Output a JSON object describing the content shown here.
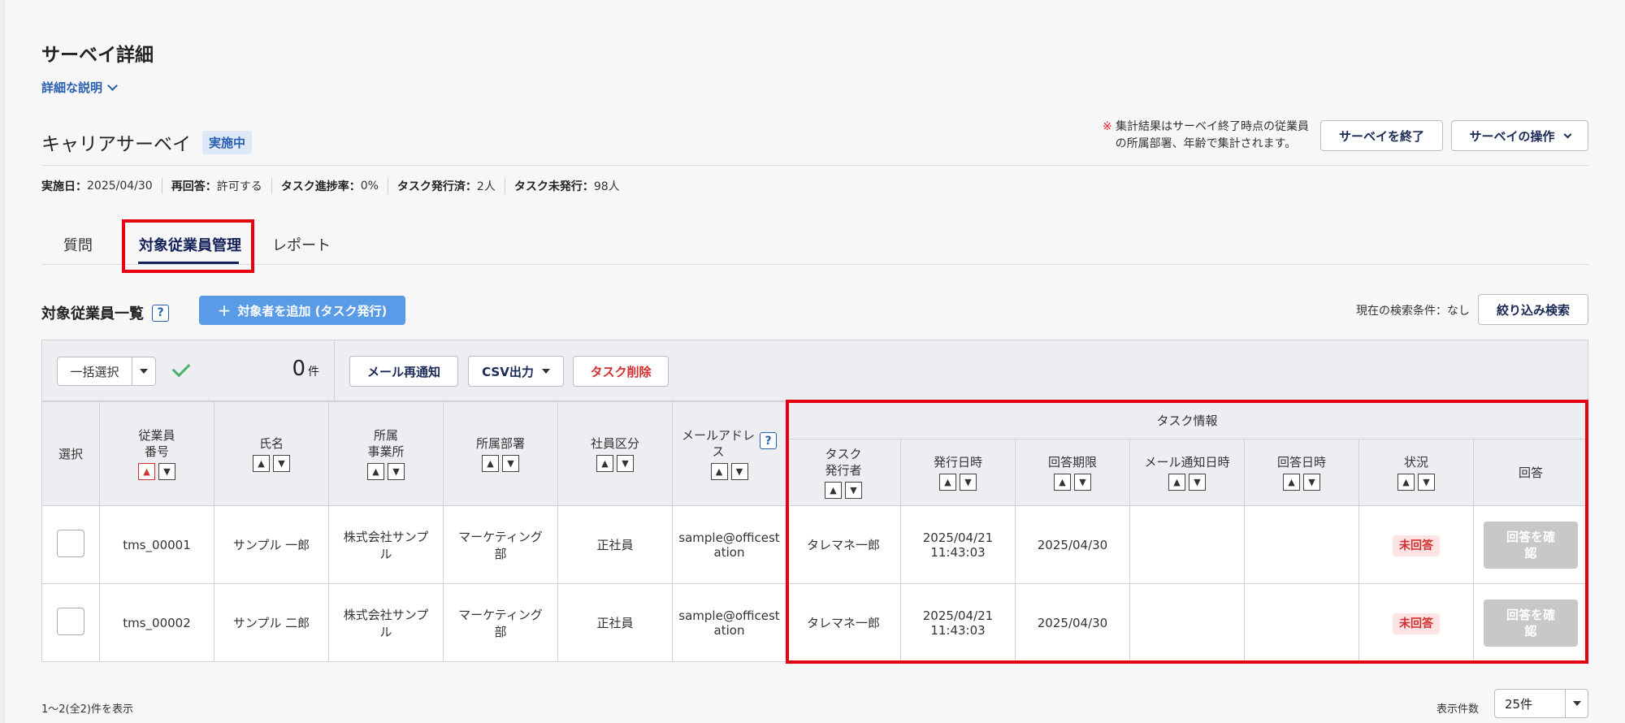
{
  "page": {
    "title": "サーベイ詳細",
    "detail_link": "詳細な説明"
  },
  "survey": {
    "name": "キャリアサーベイ",
    "status_badge": "実施中",
    "note_mark": "※",
    "note_line1": "集計結果はサーベイ終了時点の従業員",
    "note_line2": "の所属部署、年齢で集計されます。",
    "end_button": "サーベイを終了",
    "ops_button": "サーベイの操作",
    "meta": [
      {
        "label": "実施日：",
        "value": "2025/04/30"
      },
      {
        "label": "再回答：",
        "value": "許可する"
      },
      {
        "label": "タスク進捗率：",
        "value": "0%"
      },
      {
        "label": "タスク発行済：",
        "value": "2人"
      },
      {
        "label": "タスク未発行：",
        "value": "98人"
      }
    ]
  },
  "tabs": [
    {
      "label": "質問"
    },
    {
      "label": "対象従業員管理",
      "active": true
    },
    {
      "label": "レポート"
    }
  ],
  "list": {
    "title": "対象従業員一覧",
    "help": "?",
    "add_button": "対象者を追加 (タスク発行)",
    "condition": "現在の検索条件：なし",
    "filter_button": "絞り込み検索"
  },
  "toolbar": {
    "bulk_select": "一括選択",
    "count": "0",
    "count_unit": "件",
    "resend_button": "メール再通知",
    "csv_button": "CSV出力",
    "delete_button": "タスク削除"
  },
  "table": {
    "headers": {
      "select": "選択",
      "emp_no_1": "従業員",
      "emp_no_2": "番号",
      "name": "氏名",
      "office_1": "所属",
      "office_2": "事業所",
      "dept": "所属部署",
      "emp_type": "社員区分",
      "email_1": "メールアドレ",
      "email_2": "ス",
      "email_help": "?",
      "task_group": "タスク情報",
      "issuer_1": "タスク",
      "issuer_2": "発行者",
      "issued_at": "発行日時",
      "deadline": "回答期限",
      "mail_at": "メール通知日時",
      "answered_at": "回答日時",
      "status": "状況",
      "answer": "回答"
    },
    "rows": [
      {
        "emp_no": "tms_00001",
        "name": "サンプル 一郎",
        "office_1": "株式会社サンプ",
        "office_2": "ル",
        "dept_1": "マーケティング",
        "dept_2": "部",
        "emp_type": "正社員",
        "email_1": "sample@officest",
        "email_2": "ation",
        "issuer": "タレマネ一郎",
        "issued_date": "2025/04/21",
        "issued_time": "11:43:03",
        "deadline": "2025/04/30",
        "mail_at": "",
        "answered_at": "",
        "status": "未回答",
        "answer_1": "回答を確",
        "answer_2": "認"
      },
      {
        "emp_no": "tms_00002",
        "name": "サンプル 二郎",
        "office_1": "株式会社サンプ",
        "office_2": "ル",
        "dept_1": "マーケティング",
        "dept_2": "部",
        "emp_type": "正社員",
        "email_1": "sample@officest",
        "email_2": "ation",
        "issuer": "タレマネ一郎",
        "issued_date": "2025/04/21",
        "issued_time": "11:43:03",
        "deadline": "2025/04/30",
        "mail_at": "",
        "answered_at": "",
        "status": "未回答",
        "answer_1": "回答を確",
        "answer_2": "認"
      }
    ]
  },
  "footer": {
    "paging": "1～2(全2)件を表示",
    "per_page_label": "表示件数",
    "per_page_value": "25件"
  },
  "colors": {
    "accent": "#14205a",
    "link": "#2a5eb0",
    "primary_button": "#5a9be8",
    "highlight_box": "#e60012",
    "status_unanswered": "#d32f2f"
  }
}
